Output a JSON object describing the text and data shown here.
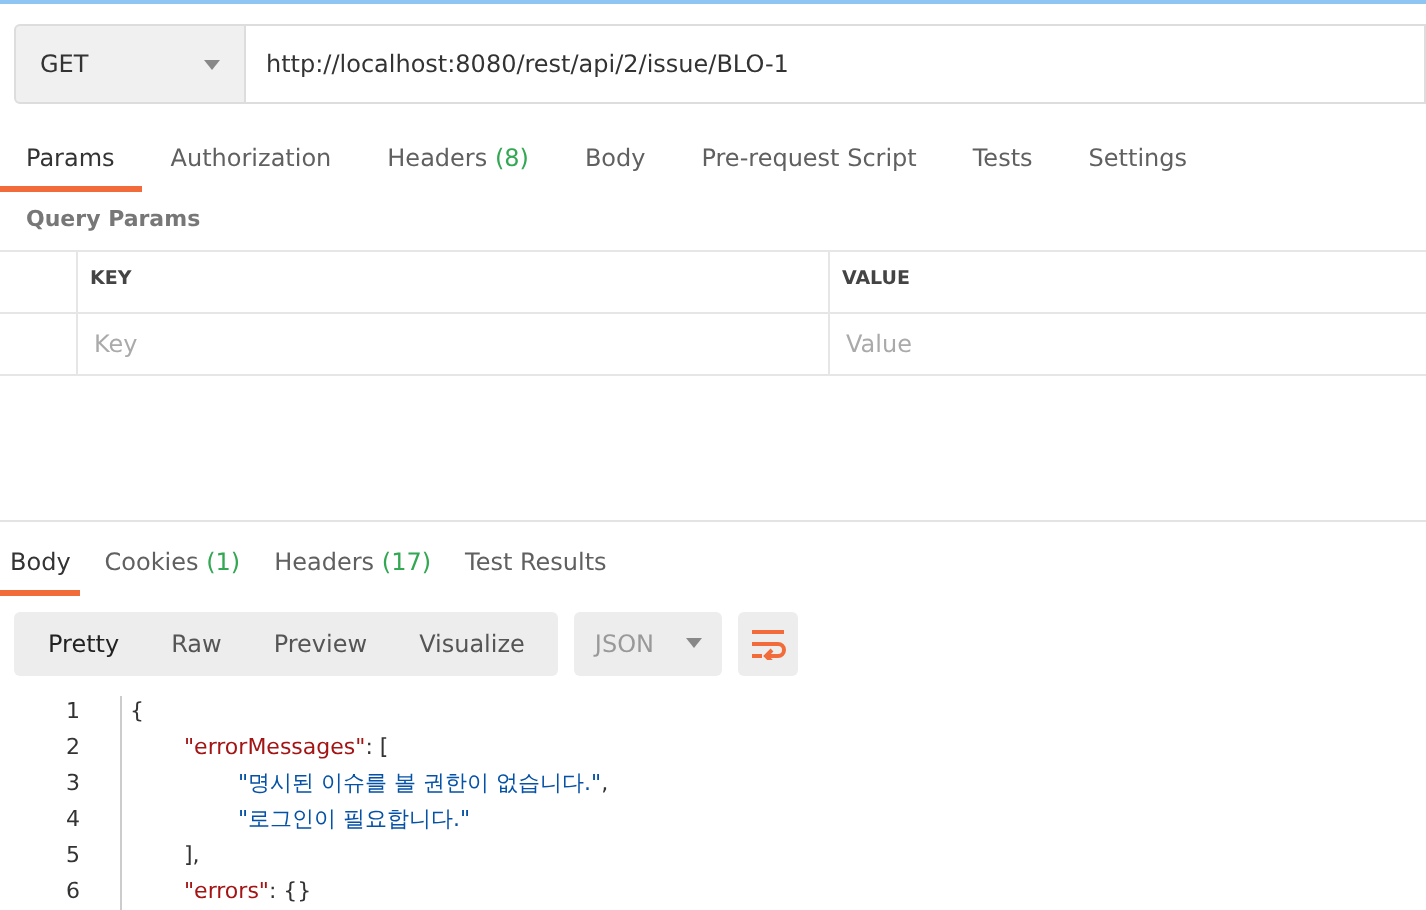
{
  "request": {
    "method": "GET",
    "url": "http://localhost:8080/rest/api/2/issue/BLO-1"
  },
  "request_tabs": [
    {
      "label": "Params",
      "selected": true
    },
    {
      "label": "Authorization",
      "selected": false
    },
    {
      "label": "Headers",
      "count": "(8)",
      "selected": false
    },
    {
      "label": "Body",
      "selected": false
    },
    {
      "label": "Pre-request Script",
      "selected": false
    },
    {
      "label": "Tests",
      "selected": false
    },
    {
      "label": "Settings",
      "selected": false
    }
  ],
  "query_params": {
    "title": "Query Params",
    "columns": [
      "KEY",
      "VALUE"
    ],
    "key_field": {
      "placeholder": "Key"
    },
    "value_field": {
      "placeholder": "Value"
    }
  },
  "response_tabs": [
    {
      "label": "Body",
      "selected": true
    },
    {
      "label": "Cookies",
      "count": "(1)",
      "selected": false
    },
    {
      "label": "Headers",
      "count": "(17)",
      "selected": false
    },
    {
      "label": "Test Results",
      "selected": false
    }
  ],
  "view_modes": [
    {
      "label": "Pretty",
      "selected": true
    },
    {
      "label": "Raw",
      "selected": false
    },
    {
      "label": "Preview",
      "selected": false
    },
    {
      "label": "Visualize",
      "selected": false
    }
  ],
  "format": "JSON",
  "code_lines": [
    {
      "number": "1",
      "tokens": [
        {
          "kind": "punct",
          "text": "{"
        }
      ],
      "children": [
        {
          "number": "2",
          "tokens": [
            {
              "kind": "key",
              "text": "\"errorMessages\""
            },
            {
              "kind": "punct",
              "text": ": ["
            }
          ],
          "children": [
            {
              "number": "3",
              "tokens": [
                {
                  "kind": "string",
                  "text": "\"명시된 이슈를 볼 권한이 없습니다.\""
                },
                {
                  "kind": "punct",
                  "text": ","
                }
              ]
            },
            {
              "number": "4",
              "tokens": [
                {
                  "kind": "string",
                  "text": "\"로그인이 필요합니다.\""
                }
              ]
            }
          ]
        },
        {
          "number": "5",
          "tokens": [
            {
              "kind": "punct",
              "text": "],"
            }
          ]
        },
        {
          "number": "6",
          "tokens": [
            {
              "kind": "key",
              "text": "\"errors\""
            },
            {
              "kind": "punct",
              "text": ": {}"
            }
          ]
        }
      ]
    }
  ]
}
